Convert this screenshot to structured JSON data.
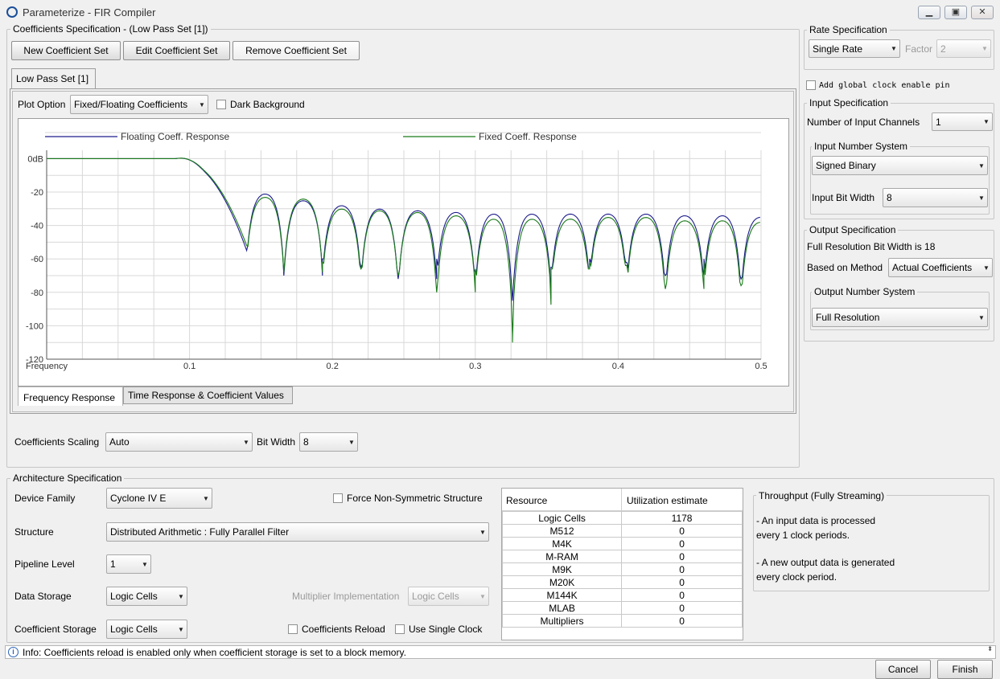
{
  "window": {
    "title": "Parameterize - FIR Compiler"
  },
  "coeffs": {
    "group_label": "Coefficients Specification - (Low Pass Set [1])",
    "new_label": "New Coefficient Set",
    "edit_label": "Edit Coefficient Set",
    "remove_label": "Remove Coefficient Set",
    "tab_label": "Low Pass Set [1]",
    "plot_option_label": "Plot Option",
    "plot_option_value": "Fixed/Floating Coefficients",
    "dark_bg_label": "Dark Background",
    "bottom_tabs": [
      "Frequency Response",
      "Time Response & Coefficient Values"
    ],
    "scaling_label": "Coefficients Scaling",
    "scaling_value": "Auto",
    "bitwidth_label": "Bit Width",
    "bitwidth_value": "8"
  },
  "chart_data": {
    "type": "line",
    "xlabel": "Frequency",
    "x_ticks": [
      "0.1",
      "0.2",
      "0.3",
      "0.4",
      "0.5"
    ],
    "y_ticks": [
      "0dB",
      "-20",
      "-40",
      "-60",
      "-80",
      "-100",
      "-120"
    ],
    "xlim": [
      0,
      0.5
    ],
    "ylim": [
      -120,
      5
    ],
    "grid": true,
    "legend_position": "top",
    "series": [
      {
        "name": "Floating Coeff. Response",
        "color": "#1c1c8c",
        "passband_end": 0.105,
        "nulls_x": [
          0.14,
          0.166,
          0.193,
          0.22,
          0.246,
          0.273,
          0.3,
          0.326,
          0.353,
          0.38,
          0.406,
          0.433,
          0.46,
          0.486
        ],
        "nulls_depth": [
          -55,
          -70,
          -60,
          -65,
          -72,
          -60,
          -68,
          -85,
          -65,
          -60,
          -62,
          -70,
          -60,
          -72
        ],
        "lobe_peaks": [
          -21,
          -25,
          -28,
          -30,
          -31,
          -32,
          -33,
          -33,
          -33,
          -33,
          -33,
          -34,
          -34,
          -35
        ]
      },
      {
        "name": "Fixed Coeff. Response",
        "color": "#1a7a1a",
        "passband_end": 0.105,
        "nulls_x": [
          0.14,
          0.166,
          0.193,
          0.22,
          0.246,
          0.273,
          0.3,
          0.326,
          0.353,
          0.38,
          0.406,
          0.433,
          0.46,
          0.486
        ],
        "nulls_depth": [
          -52,
          -68,
          -62,
          -66,
          -70,
          -80,
          -66,
          -110,
          -66,
          -62,
          -64,
          -78,
          -62,
          -76
        ],
        "lobe_peaks": [
          -23,
          -24,
          -30,
          -31,
          -32,
          -34,
          -36,
          -36,
          -36,
          -35,
          -35,
          -37,
          -37,
          -38
        ]
      }
    ]
  },
  "rate": {
    "group_label": "Rate Specification",
    "value": "Single Rate",
    "factor_label": "Factor",
    "factor_value": "2"
  },
  "clock_enable_label": "Add global clock enable pin",
  "input": {
    "group_label": "Input Specification",
    "channels_label": "Number of Input Channels",
    "channels_value": "1",
    "number_system_label": "Input Number System",
    "number_system_value": "Signed Binary",
    "bitwidth_label": "Input Bit Width",
    "bitwidth_value": "8"
  },
  "output": {
    "group_label": "Output Specification",
    "full_res_text": "Full Resolution Bit Width is 18",
    "method_label": "Based on Method",
    "method_value": "Actual Coefficients",
    "number_system_label": "Output Number System",
    "number_system_value": "Full Resolution"
  },
  "arch": {
    "group_label": "Architecture Specification",
    "device_family_label": "Device Family",
    "device_family_value": "Cyclone IV E",
    "force_nonsym_label": "Force Non-Symmetric Structure",
    "structure_label": "Structure",
    "structure_value": "Distributed Arithmetic : Fully Parallel Filter",
    "pipeline_label": "Pipeline Level",
    "pipeline_value": "1",
    "data_storage_label": "Data Storage",
    "data_storage_value": "Logic Cells",
    "mult_impl_label": "Multiplier Implementation",
    "mult_impl_value": "Logic Cells",
    "coef_storage_label": "Coefficient Storage",
    "coef_storage_value": "Logic Cells",
    "coef_reload_label": "Coefficients Reload",
    "single_clock_label": "Use Single Clock"
  },
  "resources": {
    "headers": [
      "Resource",
      "Utilization estimate"
    ],
    "rows": [
      [
        "Logic Cells",
        "1178"
      ],
      [
        "M512",
        "0"
      ],
      [
        "M4K",
        "0"
      ],
      [
        "M-RAM",
        "0"
      ],
      [
        "M9K",
        "0"
      ],
      [
        "M20K",
        "0"
      ],
      [
        "M144K",
        "0"
      ],
      [
        "MLAB",
        "0"
      ],
      [
        "Multipliers",
        "0"
      ]
    ]
  },
  "throughput": {
    "group_label": "Throughput (Fully Streaming)",
    "line1": "- An input data is processed",
    "line2": "every 1 clock periods.",
    "line3": "- A new output data is generated",
    "line4": "every clock period."
  },
  "info": {
    "text": "Info: Coefficients reload is enabled only when coefficient storage is set to a block memory."
  },
  "footer": {
    "cancel_label": "Cancel",
    "finish_label": "Finish"
  }
}
